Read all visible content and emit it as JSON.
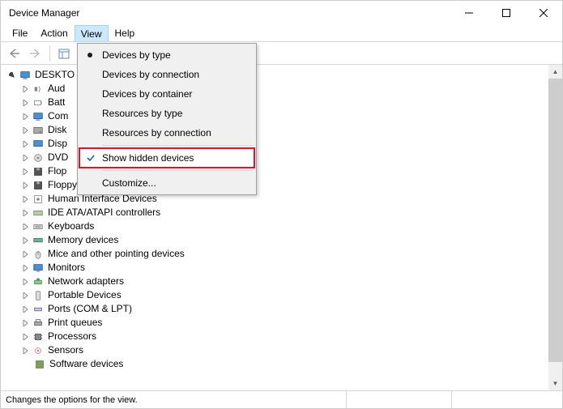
{
  "window": {
    "title": "Device Manager"
  },
  "menubar": {
    "file": "File",
    "action": "Action",
    "view": "View",
    "help": "Help"
  },
  "tree": {
    "root": "DESKTO",
    "items": [
      {
        "label": "Aud",
        "icon": "audio"
      },
      {
        "label": "Batt",
        "icon": "battery"
      },
      {
        "label": "Com",
        "icon": "computer"
      },
      {
        "label": "Disk",
        "icon": "disk"
      },
      {
        "label": "Disp",
        "icon": "display"
      },
      {
        "label": "DVD",
        "icon": "dvd"
      },
      {
        "label": "Flop",
        "icon": "floppy"
      },
      {
        "label": "Floppy drive controllers",
        "icon": "floppy"
      },
      {
        "label": "Human Interface Devices",
        "icon": "hid"
      },
      {
        "label": "IDE ATA/ATAPI controllers",
        "icon": "ide"
      },
      {
        "label": "Keyboards",
        "icon": "keyboard"
      },
      {
        "label": "Memory devices",
        "icon": "memory"
      },
      {
        "label": "Mice and other pointing devices",
        "icon": "mouse"
      },
      {
        "label": "Monitors",
        "icon": "monitor"
      },
      {
        "label": "Network adapters",
        "icon": "network"
      },
      {
        "label": "Portable Devices",
        "icon": "portable"
      },
      {
        "label": "Ports (COM & LPT)",
        "icon": "port"
      },
      {
        "label": "Print queues",
        "icon": "printer"
      },
      {
        "label": "Processors",
        "icon": "cpu"
      },
      {
        "label": "Sensors",
        "icon": "sensor"
      }
    ],
    "subitem": "Software devices"
  },
  "dropdown": {
    "devices_by_type": "Devices by type",
    "devices_by_connection": "Devices by connection",
    "devices_by_container": "Devices by container",
    "resources_by_type": "Resources by type",
    "resources_by_connection": "Resources by connection",
    "show_hidden_devices": "Show hidden devices",
    "customize": "Customize..."
  },
  "statusbar": {
    "text": "Changes the options for the view."
  }
}
